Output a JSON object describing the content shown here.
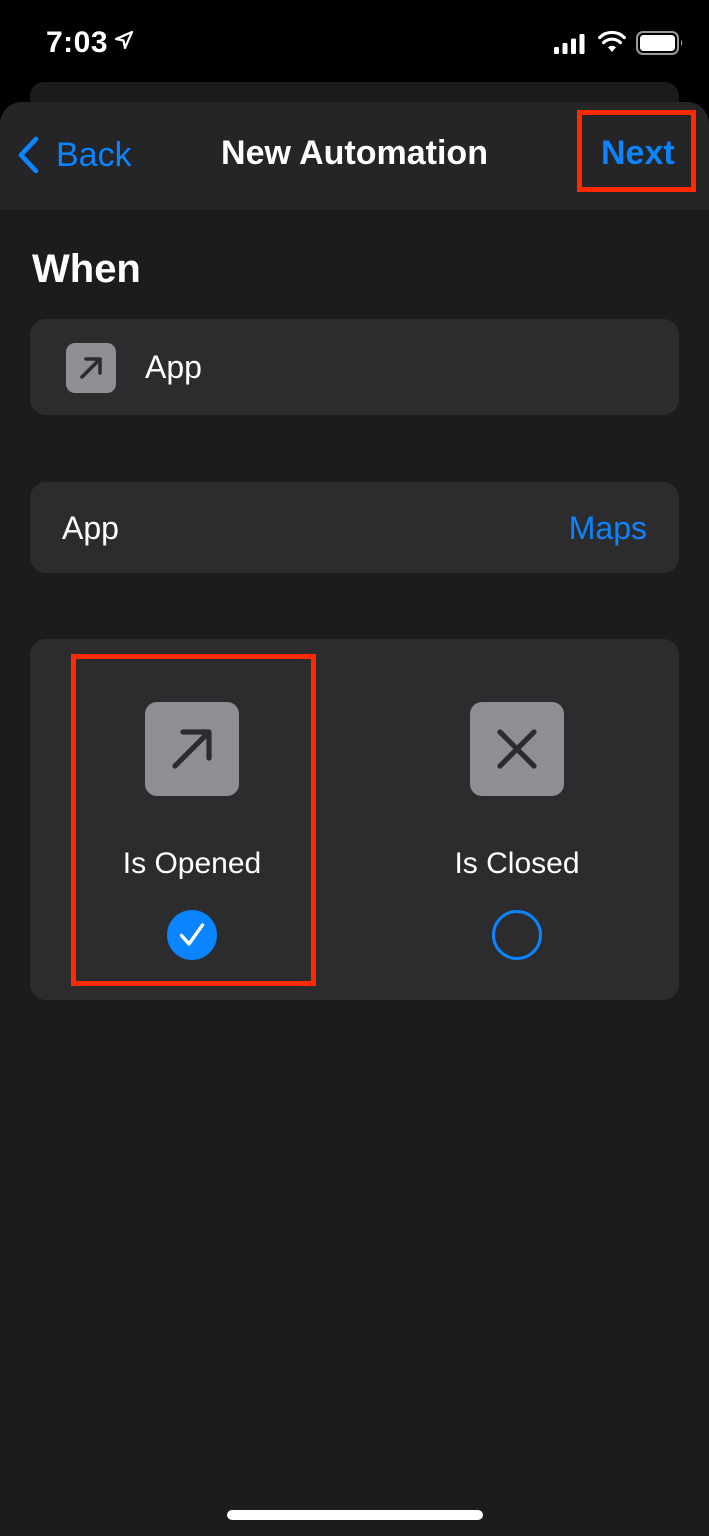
{
  "status_bar": {
    "time": "7:03",
    "icons": [
      "location-arrow-icon",
      "cellular-signal-icon",
      "wifi-icon",
      "battery-icon"
    ]
  },
  "nav": {
    "back_label": "Back",
    "title": "New Automation",
    "next_label": "Next"
  },
  "section_title": "When",
  "trigger": {
    "icon": "arrow-up-right-icon",
    "label": "App"
  },
  "app_row": {
    "label": "App",
    "value": "Maps"
  },
  "options": [
    {
      "label": "Is Opened",
      "icon": "arrow-up-right-icon",
      "selected": true
    },
    {
      "label": "Is Closed",
      "icon": "x-mark-icon",
      "selected": false
    }
  ],
  "colors": {
    "accent": "#0a84ff",
    "highlight": "#ff2a00",
    "sheet_bg": "#1c1c1e",
    "card_bg": "#2c2c2e",
    "icon_box_bg": "#8e8e93"
  }
}
